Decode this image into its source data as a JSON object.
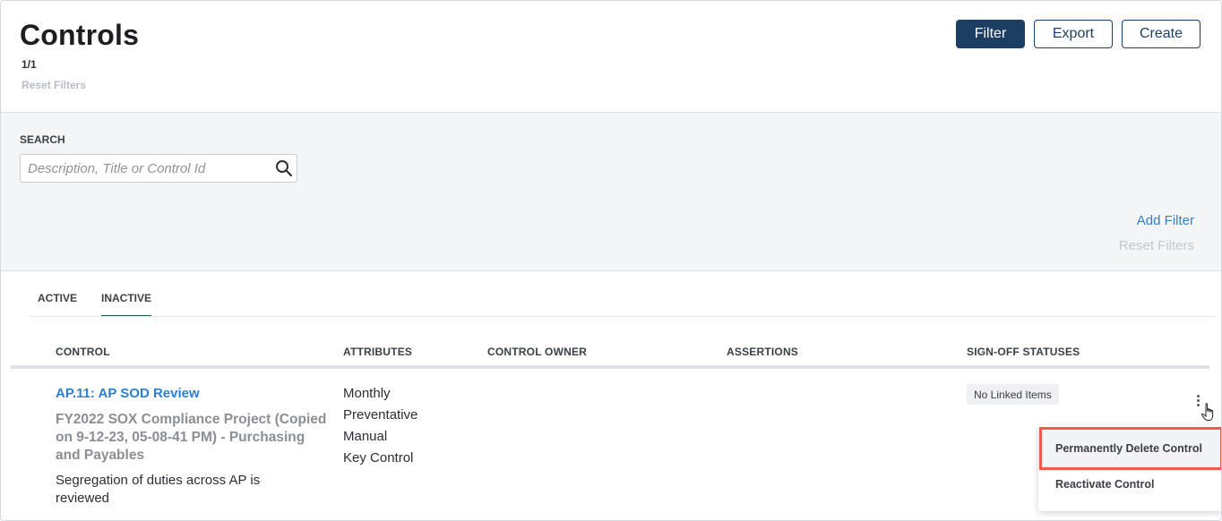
{
  "header": {
    "title": "Controls",
    "count": "1/1",
    "reset_filters": "Reset Filters",
    "buttons": {
      "filter": "Filter",
      "export": "Export",
      "create": "Create"
    }
  },
  "filter_panel": {
    "search_label": "SEARCH",
    "search_placeholder": "Description, Title or Control Id",
    "add_filter": "Add Filter",
    "reset_filters": "Reset Filters"
  },
  "tabs": [
    {
      "label": "ACTIVE",
      "selected": false
    },
    {
      "label": "INACTIVE",
      "selected": true
    }
  ],
  "table": {
    "columns": [
      "CONTROL",
      "ATTRIBUTES",
      "CONTROL OWNER",
      "ASSERTIONS",
      "SIGN-OFF STATUSES"
    ],
    "rows": [
      {
        "control_id_title": "AP.11: AP SOD Review",
        "project": "FY2022 SOX Compliance Project (Copied on 9-12-23, 05-08-41 PM) - Purchasing and Payables",
        "description": "Segregation of duties across AP is reviewed",
        "attributes": [
          "Monthly",
          "Preventative",
          "Manual",
          "Key Control"
        ],
        "control_owner": "",
        "assertions": "",
        "signoff_status": "No Linked Items"
      }
    ]
  },
  "row_menu": {
    "items": [
      "Permanently Delete Control",
      "Reactivate Control"
    ],
    "highlight_color": "#ef5a4c"
  },
  "colors": {
    "primary": "#1d3e63",
    "link": "#2c7fd0",
    "tab_underline": "#1f5c46"
  }
}
